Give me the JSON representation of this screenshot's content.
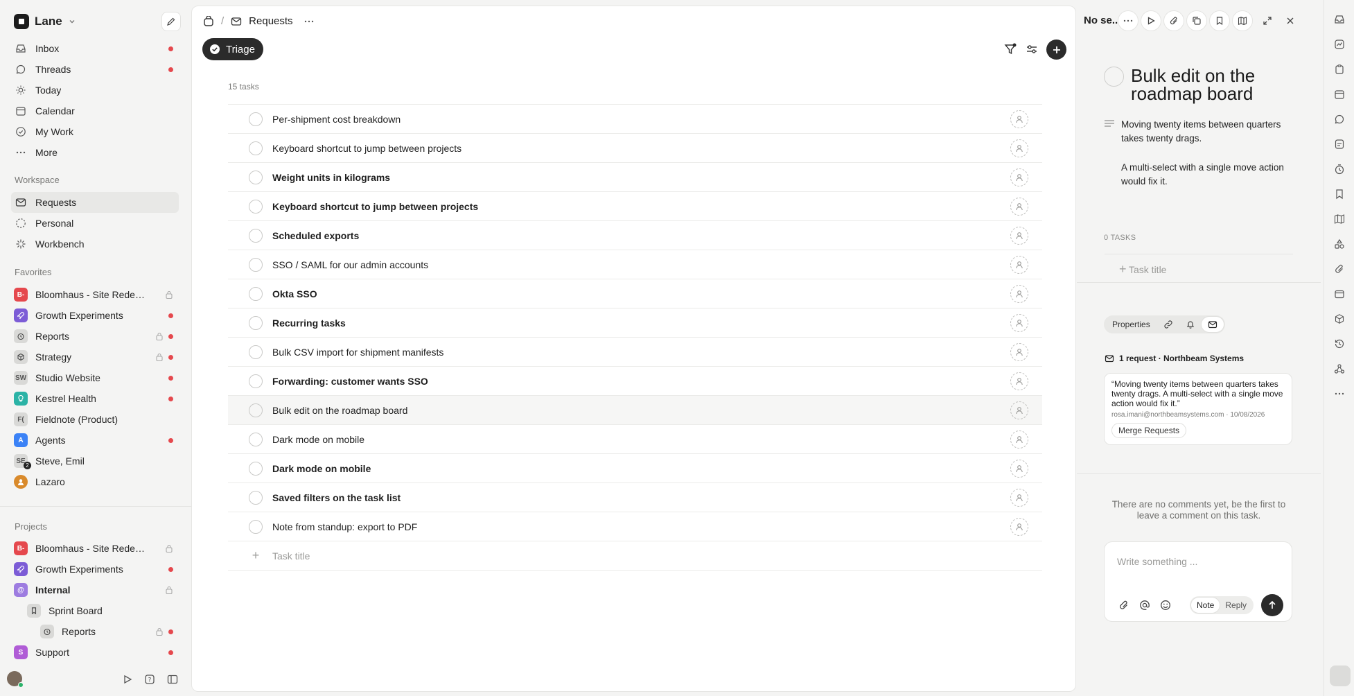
{
  "workspace": {
    "name": "Lane"
  },
  "nav": [
    {
      "label": "Inbox",
      "icon": "inbox-icon",
      "dot": true
    },
    {
      "label": "Threads",
      "icon": "threads-icon",
      "dot": true
    },
    {
      "label": "Today",
      "icon": "sun-icon",
      "dot": false
    },
    {
      "label": "Calendar",
      "icon": "calendar-icon",
      "dot": false
    },
    {
      "label": "My Work",
      "icon": "check-circle-icon",
      "dot": false
    },
    {
      "label": "More",
      "icon": "more-icon",
      "dot": false
    }
  ],
  "sections": {
    "workspace": "Workspace",
    "favorites": "Favorites",
    "projects": "Projects"
  },
  "workspace_items": [
    {
      "label": "Requests",
      "icon": "mail-icon"
    },
    {
      "label": "Personal",
      "icon": "dashed-circle-icon"
    },
    {
      "label": "Workbench",
      "icon": "spark-icon"
    }
  ],
  "favorites": [
    {
      "label": "Bloomhaus - Site Redesi...",
      "badge": "B-",
      "color": "#e5484d",
      "lock": true,
      "dot": false
    },
    {
      "label": "Growth Experiments",
      "badge": "rocket",
      "color": "#7c5cd6",
      "lock": false,
      "dot": true
    },
    {
      "label": "Reports",
      "badge": "timer",
      "color": "#d9d9d7",
      "lock": true,
      "dot": true
    },
    {
      "label": "Strategy",
      "badge": "cube",
      "color": "#d9d9d7",
      "lock": true,
      "dot": true
    },
    {
      "label": "Studio Website",
      "badge": "SW",
      "color": "#d9d9d7",
      "lock": false,
      "dot": true
    },
    {
      "label": "Kestrel Health",
      "badge": "bulb",
      "color": "#2bb3a6",
      "lock": false,
      "dot": true
    },
    {
      "label": "Fieldnote (Product)",
      "badge": "F(",
      "color": "#d9d9d7",
      "lock": false,
      "dot": false
    },
    {
      "label": "Agents",
      "badge": "A",
      "color": "#3b82f6",
      "lock": false,
      "dot": true
    },
    {
      "label": "Steve, Emil",
      "badge": "SE",
      "color": "#d9d9d7",
      "lock": false,
      "dot": false,
      "count": "2"
    },
    {
      "label": "Lazaro",
      "badge": "avatar",
      "color": "#d98a2b",
      "lock": false,
      "dot": false
    }
  ],
  "projects": [
    {
      "label": "Bloomhaus - Site Redesi...",
      "badge": "B-",
      "color": "#e5484d",
      "lock": true,
      "dot": false,
      "indent": 0
    },
    {
      "label": "Growth Experiments",
      "badge": "rocket",
      "color": "#7c5cd6",
      "lock": false,
      "dot": true,
      "indent": 0
    },
    {
      "label": "Internal",
      "badge": "@",
      "color": "#9d7ce0",
      "lock": true,
      "dot": false,
      "indent": 0,
      "bold": true,
      "active": true
    },
    {
      "label": "Sprint Board",
      "badge": "bookmark",
      "color": "#d9d9d7",
      "lock": false,
      "dot": false,
      "indent": 1
    },
    {
      "label": "Reports",
      "badge": "timer",
      "color": "#d9d9d7",
      "lock": true,
      "dot": true,
      "indent": 2
    },
    {
      "label": "Support",
      "badge": "S",
      "color": "#b05cd6",
      "lock": false,
      "dot": true,
      "indent": 0
    }
  ],
  "main": {
    "breadcrumb": "Requests",
    "view": "Triage",
    "task_count": "15 tasks",
    "add_task_placeholder": "Task title"
  },
  "tasks": [
    {
      "title": "Per-shipment cost breakdown",
      "bold": false
    },
    {
      "title": "Keyboard shortcut to jump between projects",
      "bold": false
    },
    {
      "title": "Weight units in kilograms",
      "bold": true
    },
    {
      "title": "Keyboard shortcut to jump between projects",
      "bold": true
    },
    {
      "title": "Scheduled exports",
      "bold": true
    },
    {
      "title": "SSO / SAML for our admin accounts",
      "bold": false
    },
    {
      "title": "Okta SSO",
      "bold": true
    },
    {
      "title": "Recurring tasks",
      "bold": true
    },
    {
      "title": "Bulk CSV import for shipment manifests",
      "bold": false
    },
    {
      "title": "Forwarding: customer wants SSO",
      "bold": true
    },
    {
      "title": "Bulk edit on the roadmap board",
      "bold": false,
      "selected": true
    },
    {
      "title": "Dark mode on mobile",
      "bold": false
    },
    {
      "title": "Dark mode on mobile",
      "bold": true
    },
    {
      "title": "Saved filters on the task list",
      "bold": true
    },
    {
      "title": "Note from standup: export to PDF",
      "bold": false
    }
  ],
  "detail": {
    "top_title": "No se...",
    "title": "Bulk edit on the roadmap board",
    "description_1": "Moving twenty items between quarters takes twenty drags.",
    "description_2": "A multi-select with a single move action would fix it.",
    "tasks_label": "0 TASKS",
    "task_placeholder": "Task title",
    "tab_properties": "Properties",
    "request_header": "1 request · Northbeam Systems",
    "request_quote": "“Moving twenty items between quarters takes twenty drags. A multi-select with a single move action would fix it.”",
    "request_meta": "rosa.imani@northbeamsystems.com · 10/08/2026",
    "merge_label": "Merge Requests",
    "no_comments": "There are no comments yet, be the first to leave a comment on this task.",
    "composer_placeholder": "Write something ...",
    "note_label": "Note",
    "reply_label": "Reply"
  },
  "colors": {
    "accent_dark": "#2b2b2b",
    "unread_dot": "#e5484d"
  }
}
